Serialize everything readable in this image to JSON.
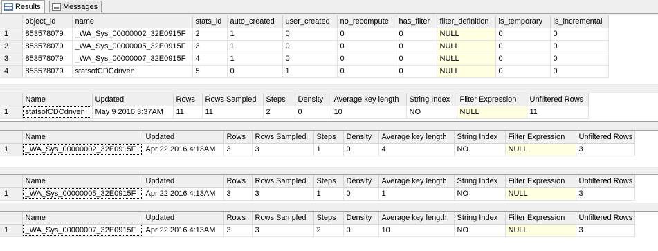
{
  "tabs": [
    {
      "label": "Results",
      "active": true,
      "icon": "grid-icon"
    },
    {
      "label": "Messages",
      "active": false,
      "icon": "messages-icon"
    }
  ],
  "colors": {
    "null_cell": "#ffffe1",
    "header": "#f0f0f0",
    "grid_line": "#e3e3e3"
  },
  "stats_table": {
    "columns": [
      "object_id",
      "name",
      "stats_id",
      "auto_created",
      "user_created",
      "no_recompute",
      "has_filter",
      "filter_definition",
      "is_temporary",
      "is_incremental"
    ],
    "rows": [
      {
        "rn": "1",
        "cells": [
          "853578079",
          "_WA_Sys_00000002_32E0915F",
          "2",
          "1",
          "0",
          "0",
          "0",
          "NULL",
          "0",
          "0"
        ]
      },
      {
        "rn": "2",
        "cells": [
          "853578079",
          "_WA_Sys_00000005_32E0915F",
          "3",
          "1",
          "0",
          "0",
          "0",
          "NULL",
          "0",
          "0"
        ]
      },
      {
        "rn": "3",
        "cells": [
          "853578079",
          "_WA_Sys_00000007_32E0915F",
          "4",
          "1",
          "0",
          "0",
          "0",
          "NULL",
          "0",
          "0"
        ]
      },
      {
        "rn": "4",
        "cells": [
          "853578079",
          "statsofCDCdriven",
          "5",
          "0",
          "1",
          "0",
          "0",
          "NULL",
          "0",
          "0"
        ]
      }
    ]
  },
  "header_columns": [
    "Name",
    "Updated",
    "Rows",
    "Rows Sampled",
    "Steps",
    "Density",
    "Average key length",
    "String Index",
    "Filter Expression",
    "Unfiltered Rows"
  ],
  "detail_tables": [
    {
      "rn": "1",
      "cells": [
        "statsofCDCdriven",
        "May  9 2016  3:37AM",
        "11",
        "11",
        "2",
        "0",
        "10",
        "NO",
        "NULL",
        "11"
      ]
    },
    {
      "rn": "1",
      "cells": [
        "_WA_Sys_00000002_32E0915F",
        "Apr 22 2016  4:13AM",
        "3",
        "3",
        "1",
        "0",
        "4",
        "NO",
        "NULL",
        "3"
      ]
    },
    {
      "rn": "1",
      "cells": [
        "_WA_Sys_00000005_32E0915F",
        "Apr 22 2016  4:13AM",
        "3",
        "3",
        "1",
        "0",
        "1",
        "NO",
        "NULL",
        "3"
      ]
    },
    {
      "rn": "1",
      "cells": [
        "_WA_Sys_00000007_32E0915F",
        "Apr 22 2016  4:13AM",
        "3",
        "3",
        "2",
        "0",
        "10",
        "NO",
        "NULL",
        "3"
      ]
    }
  ]
}
